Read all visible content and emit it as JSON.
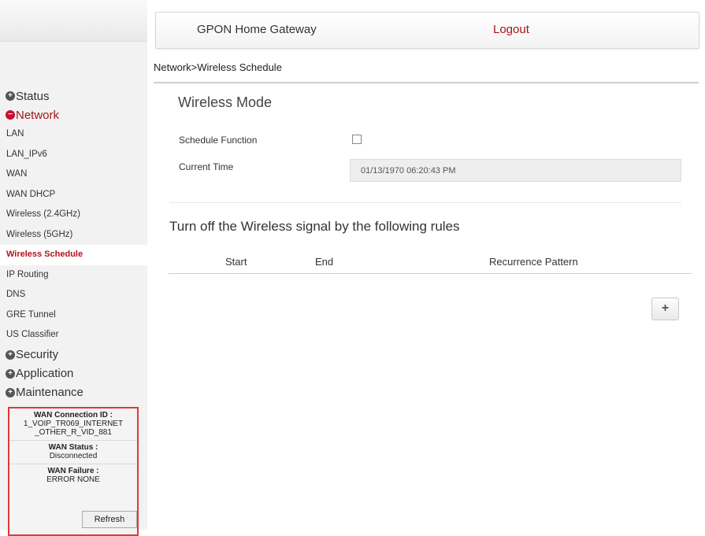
{
  "header": {
    "title": "GPON Home Gateway",
    "logout": "Logout"
  },
  "breadcrumb": "Network>Wireless Schedule",
  "sidebar": {
    "categories": [
      {
        "label": "Status",
        "icon": "plus-icon"
      },
      {
        "label": "Network",
        "icon": "minus-icon",
        "items": [
          "LAN",
          "LAN_IPv6",
          "WAN",
          "WAN DHCP",
          "Wireless (2.4GHz)",
          "Wireless (5GHz)",
          "Wireless Schedule",
          "IP Routing",
          "DNS",
          "GRE Tunnel",
          "US Classifier"
        ],
        "selected": "Wireless Schedule"
      },
      {
        "label": "Security",
        "icon": "plus-icon"
      },
      {
        "label": "Application",
        "icon": "plus-icon"
      },
      {
        "label": "Maintenance",
        "icon": "plus-icon"
      }
    ]
  },
  "wan_info": {
    "conn_label": "WAN Connection ID :",
    "conn_value": "1_VOIP_TR069_INTERNET _OTHER_R_VID_881",
    "status_label": "WAN Status :",
    "status_value": "Disconnected",
    "failure_label": "WAN Failure :",
    "failure_value": "ERROR NONE",
    "refresh": "Refresh"
  },
  "main": {
    "section_title": "Wireless Mode",
    "schedule_label": "Schedule Function",
    "schedule_checked": false,
    "time_label": "Current Time",
    "time_value": "01/13/1970 06:20:43 PM",
    "rules_title": "Turn off the Wireless signal by the following rules",
    "columns": [
      "Start",
      "End",
      "Recurrence Pattern"
    ],
    "add_label": "+"
  },
  "colors": {
    "accent": "#a3161a",
    "wan_border": "#e23838"
  }
}
